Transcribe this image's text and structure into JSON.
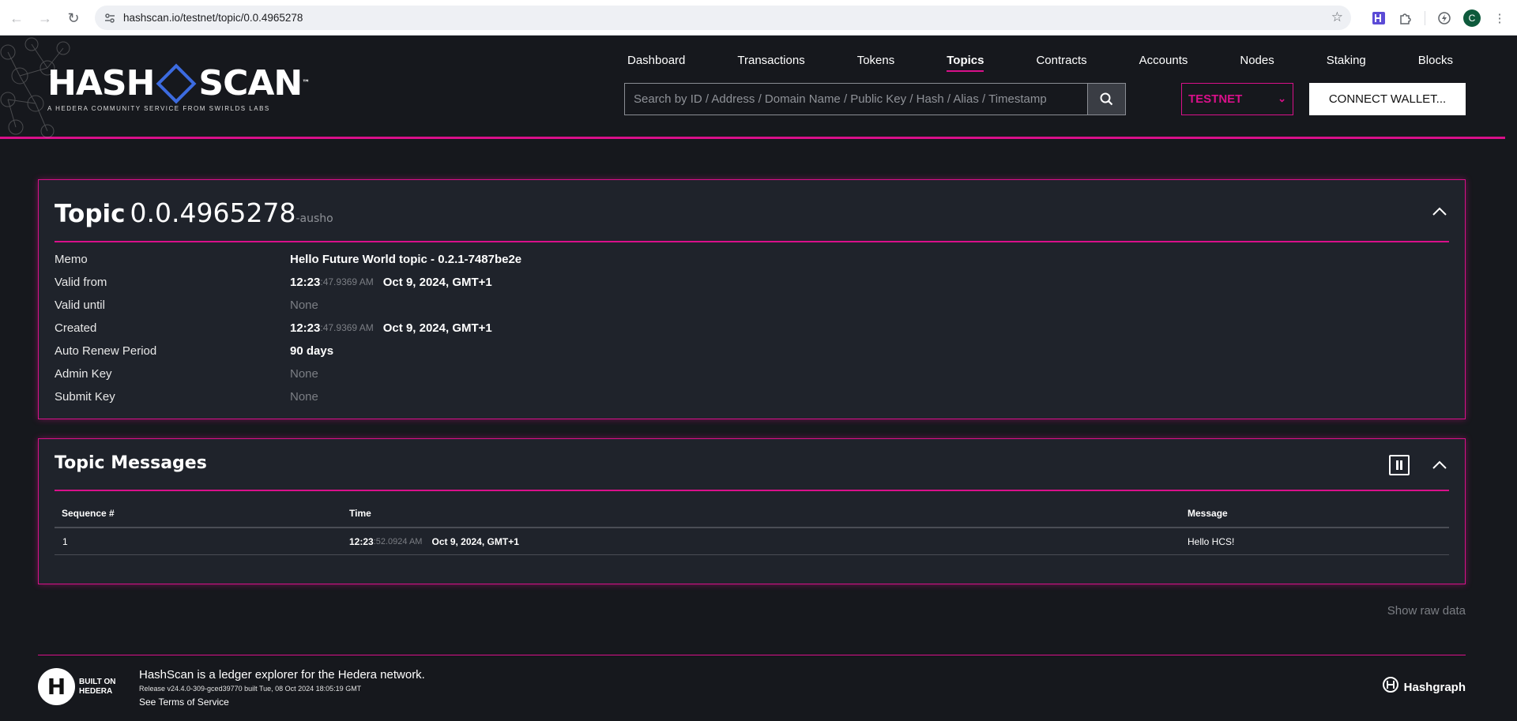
{
  "browser": {
    "url": "hashscan.io/testnet/topic/0.0.4965278"
  },
  "header": {
    "logo_text_left": "HASH",
    "logo_text_right": "SCAN",
    "logo_tm": "™",
    "logo_subtitle": "A HEDERA COMMUNITY SERVICE FROM SWIRLDS LABS",
    "nav": [
      "Dashboard",
      "Transactions",
      "Tokens",
      "Topics",
      "Contracts",
      "Accounts",
      "Nodes",
      "Staking",
      "Blocks"
    ],
    "active_nav": "Topics",
    "search_placeholder": "Search by ID / Address / Domain Name / Public Key / Hash / Alias / Timestamp",
    "network": "TESTNET",
    "connect_label": "CONNECT WALLET..."
  },
  "topic": {
    "title": "Topic",
    "id": "0.0.4965278",
    "checksum": "-ausho",
    "properties": [
      {
        "key": "Memo",
        "value": "Hello Future World topic - 0.2.1-7487be2e"
      },
      {
        "key": "Valid from",
        "time": "12:23",
        "seconds": ":47.9369 AM",
        "date": "Oct 9, 2024, GMT+1"
      },
      {
        "key": "Valid until",
        "value": "None",
        "none": true
      },
      {
        "key": "Created",
        "time": "12:23",
        "seconds": ":47.9369 AM",
        "date": "Oct 9, 2024, GMT+1"
      },
      {
        "key": "Auto Renew Period",
        "value": "90 days"
      },
      {
        "key": "Admin Key",
        "value": "None",
        "none": true
      },
      {
        "key": "Submit Key",
        "value": "None",
        "none": true
      }
    ]
  },
  "messages": {
    "title": "Topic Messages",
    "columns": [
      "Sequence #",
      "Time",
      "Message"
    ],
    "rows": [
      {
        "seq": "1",
        "time": "12:23",
        "seconds": ":52.0924 AM",
        "date": "Oct 9, 2024, GMT+1",
        "message": "Hello HCS!"
      }
    ]
  },
  "show_raw": "Show raw data",
  "footer": {
    "built_on": "BUILT ON",
    "hedera": "HEDERA",
    "description": "HashScan is a ledger explorer for the Hedera network.",
    "release": "Release v24.4.0-309-gced39770 built Tue, 08 Oct 2024 18:05:19 GMT",
    "terms": "See Terms of Service",
    "hashgraph": "Hashgraph"
  },
  "colors": {
    "accent": "#d9108a",
    "background": "#16181d",
    "card": "#1f232b",
    "logo_blue": "#3c6be0"
  }
}
